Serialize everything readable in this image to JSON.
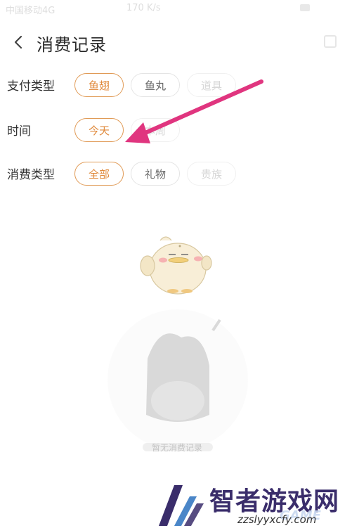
{
  "status_bar": {
    "carrier": "中国移动4G",
    "speed": "170 K/s"
  },
  "header": {
    "title": "消费记录",
    "back_icon": "chevron-left-icon",
    "menu_icon": "more-icon"
  },
  "filters": {
    "payment_type": {
      "label": "支付类型",
      "options": [
        "鱼翅",
        "鱼丸",
        "道具"
      ],
      "selected": "鱼翅"
    },
    "time": {
      "label": "时间",
      "options": [
        "今天",
        "本周"
      ],
      "selected": "今天"
    },
    "spend_type": {
      "label": "消费类型",
      "options": [
        "全部",
        "礼物",
        "贵族"
      ],
      "selected": "全部"
    }
  },
  "empty_state": {
    "caption": "暂无消费记录"
  },
  "annotation": {
    "arrow_color": "#e0357f"
  },
  "watermark": {
    "title": "智者游戏网",
    "url": "zzslyyxcfy.com",
    "tag": "GAME"
  },
  "colors": {
    "accent": "#e08a3c",
    "accent_border": "#e09a55",
    "chip_border": "#e4e4e4"
  }
}
